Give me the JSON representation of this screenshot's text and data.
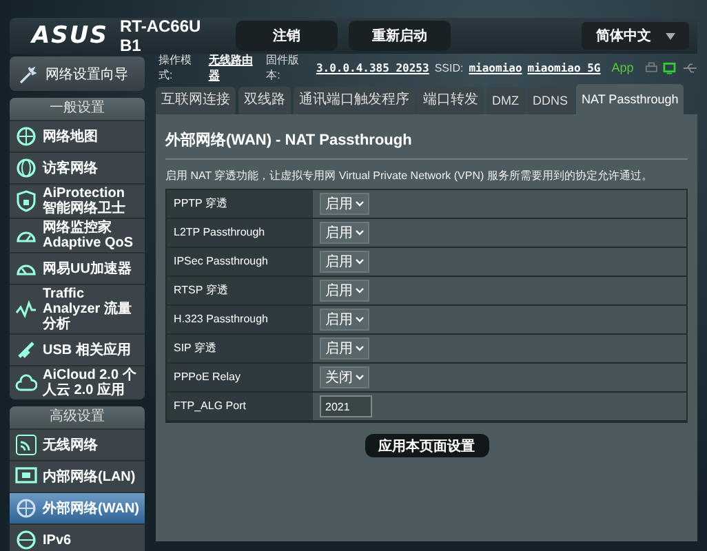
{
  "header": {
    "logo": "ASUS",
    "model": "RT-AC66U B1",
    "buttons": [
      "注销",
      "重新启动"
    ],
    "language": "简体中文"
  },
  "sidebar": {
    "wizard": "网络设置向导",
    "sections": [
      {
        "title": "一般设置",
        "items": [
          {
            "label": "网络地图",
            "selected": false
          },
          {
            "label": "访客网络",
            "selected": false
          },
          {
            "label": "AiProtection 智能网络卫士",
            "selected": false
          },
          {
            "label": "网络监控家 Adaptive QoS",
            "selected": false
          },
          {
            "label": "网易UU加速器",
            "selected": false
          },
          {
            "label": "Traffic Analyzer 流量分析",
            "selected": false
          },
          {
            "label": "USB 相关应用",
            "selected": false
          },
          {
            "label": "AiCloud 2.0 个人云 2.0 应用",
            "selected": false
          }
        ]
      },
      {
        "title": "高级设置",
        "items": [
          {
            "label": "无线网络",
            "selected": false
          },
          {
            "label": "内部网络(LAN)",
            "selected": false
          },
          {
            "label": "外部网络(WAN)",
            "selected": true
          },
          {
            "label": "IPv6",
            "selected": false
          }
        ]
      }
    ]
  },
  "status": {
    "mode_label": "操作模式:",
    "mode": "无线路由器",
    "firmware_label": "固件版本:",
    "firmware": "3.0.0.4.385_20253",
    "ssid_label": "SSID:",
    "ssids": [
      "miaomiao",
      "miaomiao_5G"
    ],
    "app": "App"
  },
  "tabs": [
    {
      "label": "互联网连接",
      "selected": false
    },
    {
      "label": "双线路",
      "selected": false
    },
    {
      "label": "通讯端口触发程序",
      "selected": false
    },
    {
      "label": "端口转发",
      "selected": false
    },
    {
      "label": "DMZ",
      "selected": false
    },
    {
      "label": "DDNS",
      "selected": false
    },
    {
      "label": "NAT Passthrough",
      "selected": true
    }
  ],
  "panel": {
    "title": "外部网络(WAN) - NAT Passthrough",
    "description": "启用 NAT 穿透功能，让虚拟专用网 Virtual Private Network (VPN) 服务所需要用到的协定允许通过。",
    "rows": [
      {
        "label": "PPTP 穿透",
        "kind": "select",
        "value": "启用"
      },
      {
        "label": "L2TP Passthrough",
        "kind": "select",
        "value": "启用"
      },
      {
        "label": "IPSec Passthrough",
        "kind": "select",
        "value": "启用"
      },
      {
        "label": "RTSP 穿透",
        "kind": "select",
        "value": "启用"
      },
      {
        "label": "H.323 Passthrough",
        "kind": "select",
        "value": "启用"
      },
      {
        "label": "SIP 穿透",
        "kind": "select",
        "value": "启用"
      },
      {
        "label": "PPPoE Relay",
        "kind": "select",
        "value": "关闭"
      },
      {
        "label": "FTP_ALG Port",
        "kind": "input",
        "value": "2021"
      }
    ],
    "apply": "应用本页面设置"
  }
}
